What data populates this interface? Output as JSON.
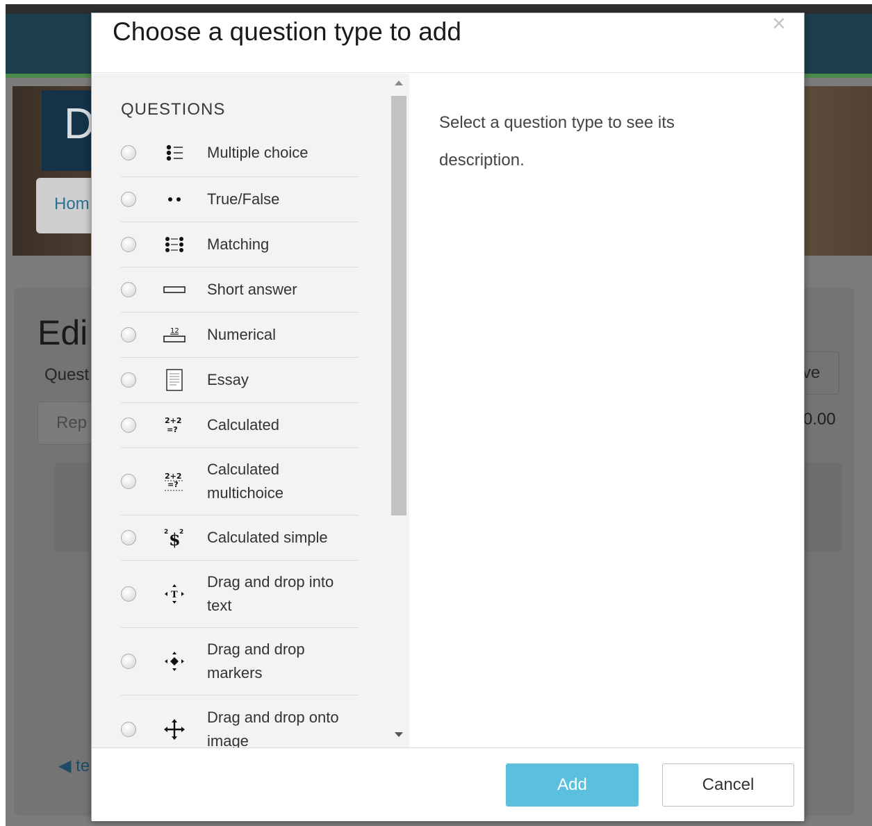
{
  "background": {
    "logo_letter": "D",
    "breadcrumb_home": "Hom",
    "heading": "Edi",
    "questions_label": "Quest",
    "repaginate": "Rep",
    "save_button": "ve",
    "max_mark": "0.00",
    "back_link": "◀ te"
  },
  "modal": {
    "title": "Choose a question type to add",
    "close_symbol": "×",
    "section_heading": "QUESTIONS",
    "options": [
      {
        "label": "Multiple choice",
        "icon": "multiple-choice-icon"
      },
      {
        "label": "True/False",
        "icon": "true-false-icon"
      },
      {
        "label": "Matching",
        "icon": "matching-icon"
      },
      {
        "label": "Short answer",
        "icon": "short-answer-icon"
      },
      {
        "label": "Numerical",
        "icon": "numerical-icon"
      },
      {
        "label": "Essay",
        "icon": "essay-icon"
      },
      {
        "label": "Calculated",
        "icon": "calculated-icon"
      },
      {
        "label": "Calculated multichoice",
        "icon": "calculated-multichoice-icon"
      },
      {
        "label": "Calculated simple",
        "icon": "calculated-simple-icon"
      },
      {
        "label": "Drag and drop into text",
        "icon": "drag-drop-text-icon"
      },
      {
        "label": "Drag and drop markers",
        "icon": "drag-drop-markers-icon"
      },
      {
        "label": "Drag and drop onto image",
        "icon": "drag-drop-image-icon"
      }
    ],
    "description_placeholder": "Select a question type to see its description.",
    "add_button": "Add",
    "cancel_button": "Cancel"
  },
  "colors": {
    "add_button_bg": "#5bc0de",
    "options_pane_bg": "#f3f3f3",
    "nav_bg": "#1d3e4d"
  }
}
